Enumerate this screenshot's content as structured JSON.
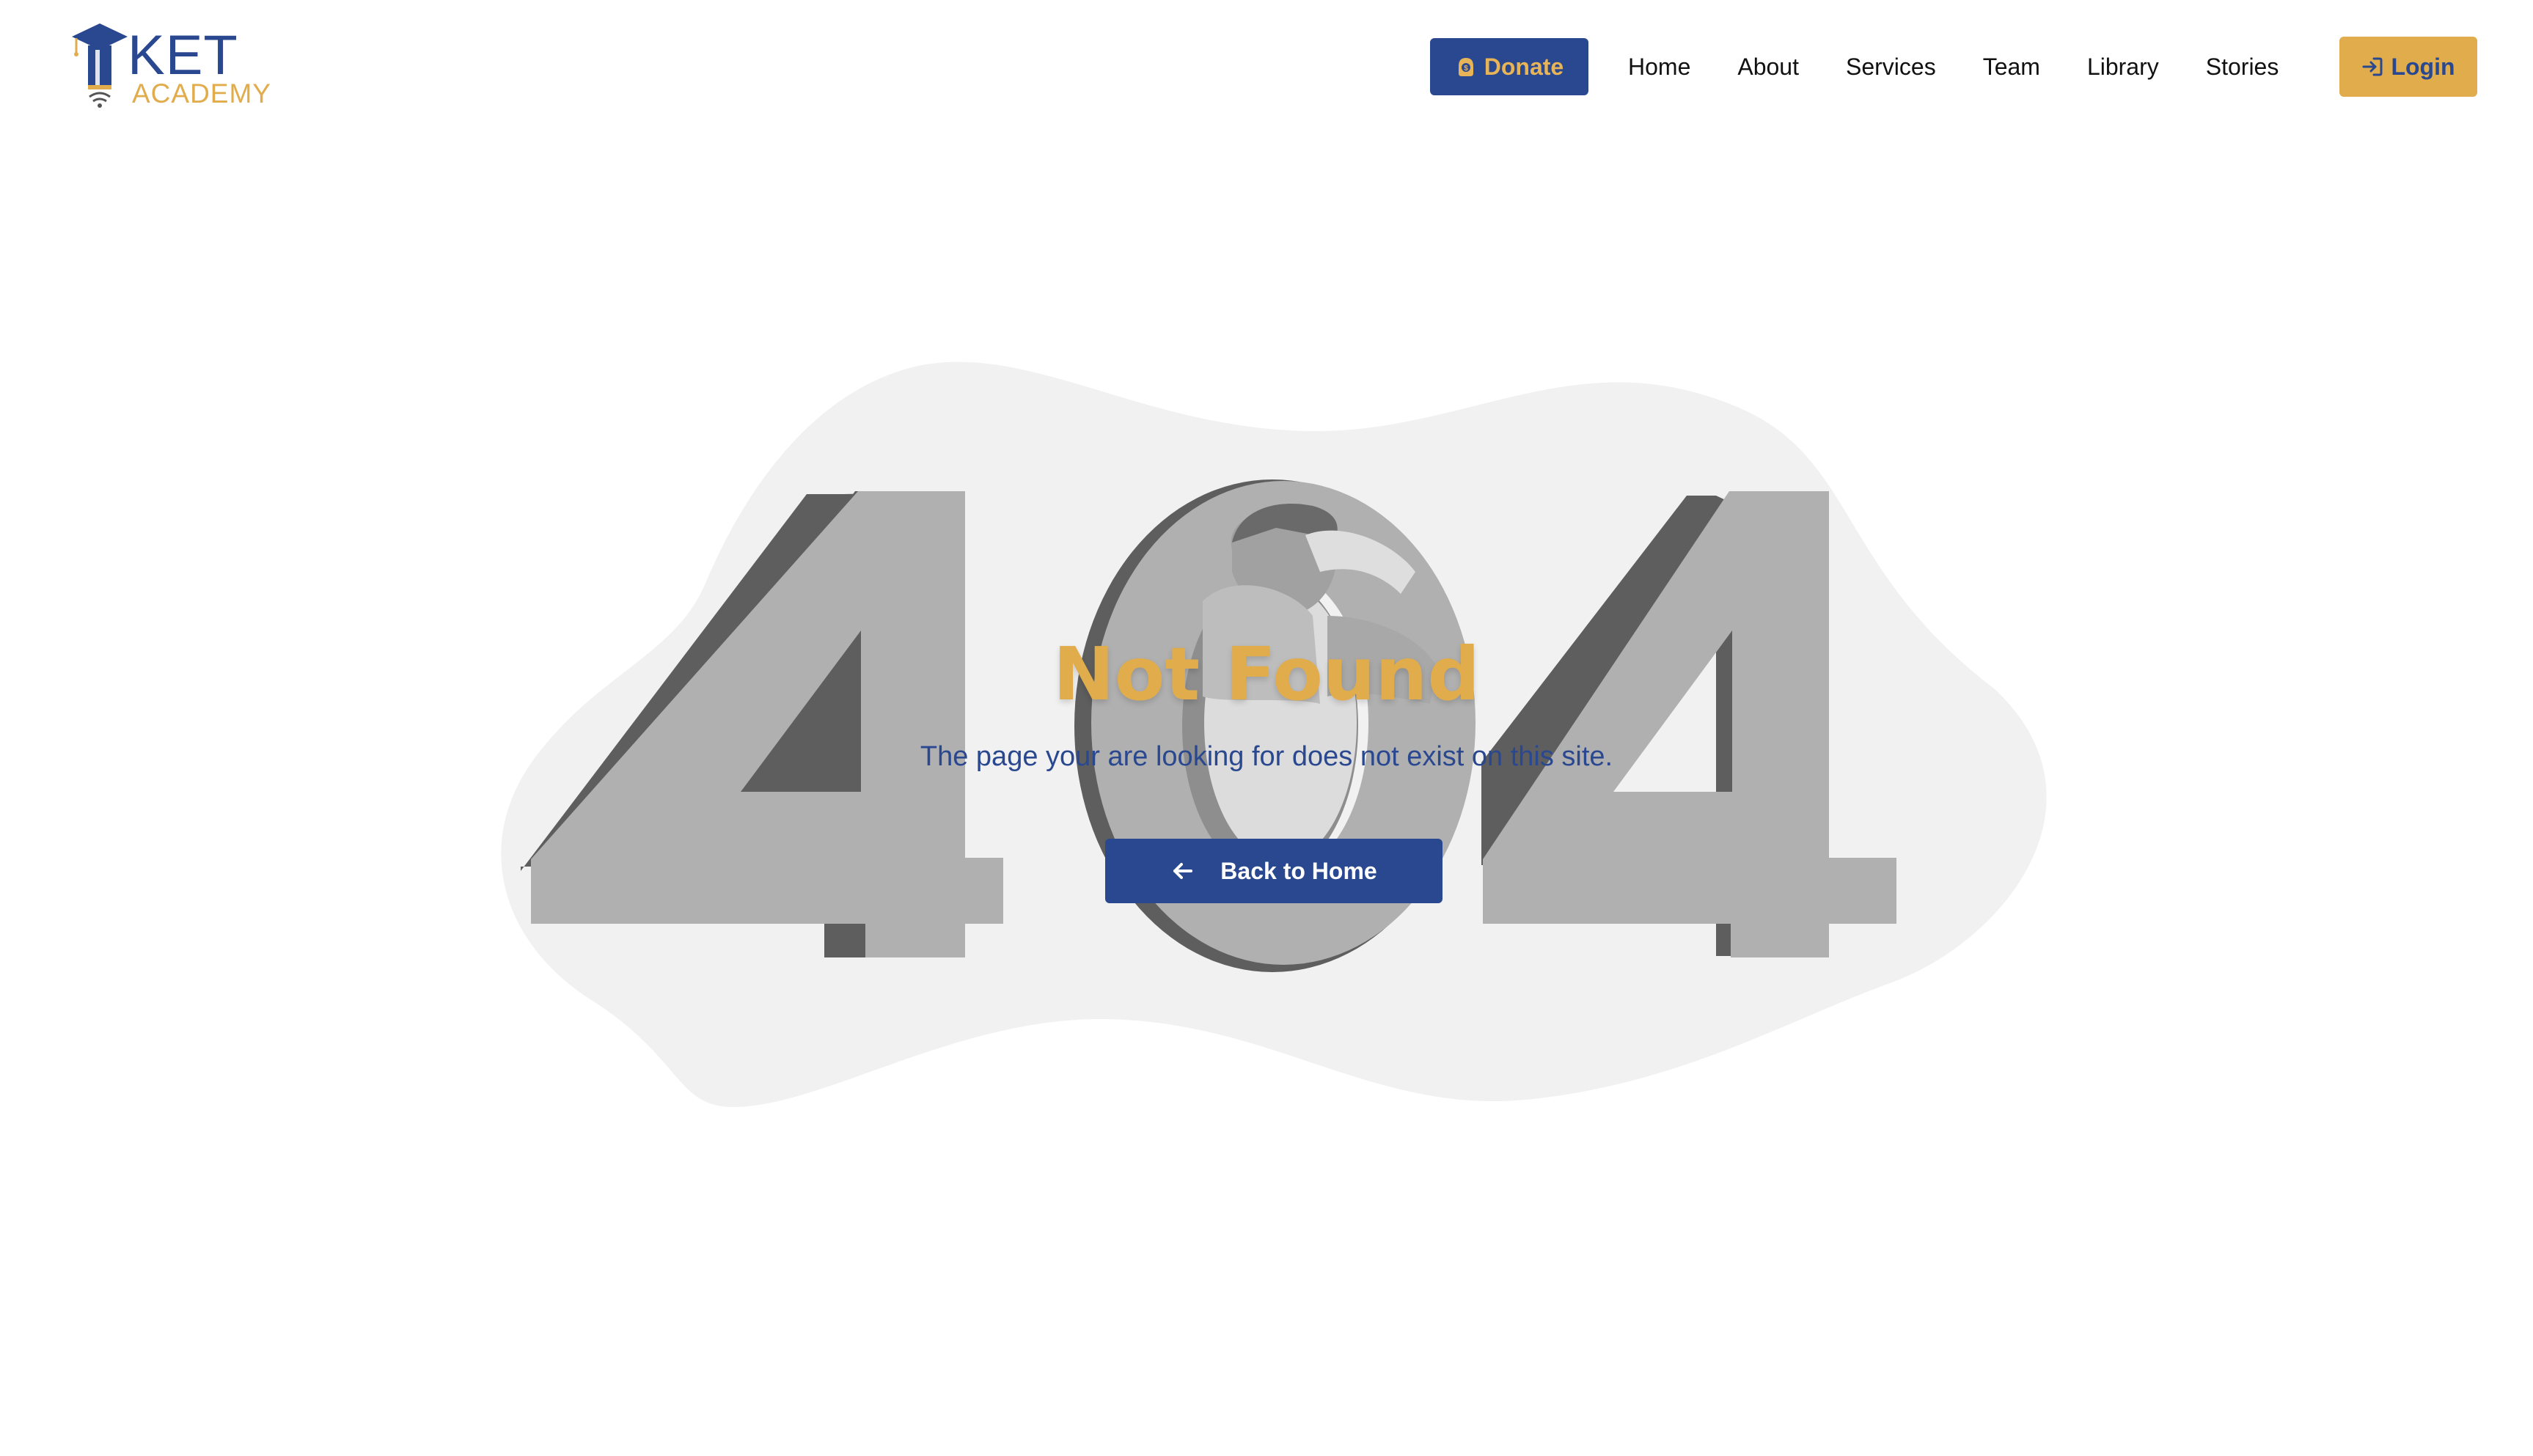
{
  "brand": {
    "name_main": "KET",
    "name_sub": "ACADEMY",
    "logo_icon": "graduation-cap-pencil-icon"
  },
  "header": {
    "donate_label": "Donate",
    "donate_icon": "coin-icon",
    "nav_items": [
      {
        "label": "Home"
      },
      {
        "label": "About"
      },
      {
        "label": "Services"
      },
      {
        "label": "Team"
      },
      {
        "label": "Library"
      },
      {
        "label": "Stories"
      }
    ],
    "login_label": "Login",
    "login_icon": "sign-in-icon"
  },
  "error": {
    "code": "404",
    "title": "Not Found",
    "message": "The page your are looking for does not exist on this site.",
    "back_label": "Back to Home",
    "back_icon": "arrow-left-icon"
  },
  "colors": {
    "primary": "#2a4890",
    "accent": "#e0ac4c",
    "blob": "#f1f1f1",
    "digit_face": "#b0b0b0",
    "digit_side": "#5e5e5e"
  }
}
